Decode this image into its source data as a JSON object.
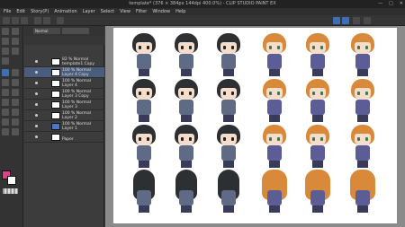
{
  "window": {
    "title": "template* (376 × 384px 144dpi 400.0%) - CLIP STUDIO PAINT EX",
    "controls": [
      "—",
      "□",
      "✕"
    ]
  },
  "menu": [
    "File",
    "Edit",
    "Story(P)",
    "Animation",
    "Layer",
    "Select",
    "View",
    "Filter",
    "Window",
    "Help"
  ],
  "layer_panel": {
    "blend_mode": "Normal",
    "layers": [
      {
        "line1": "82 % Normal",
        "line2": "template1 Copy",
        "selected": false,
        "thumb": "white"
      },
      {
        "line1": "100 % Normal",
        "line2": "Layer 4 Copy",
        "selected": true,
        "thumb": "white"
      },
      {
        "line1": "100 % Normal",
        "line2": "Layer 4",
        "selected": false,
        "thumb": "white"
      },
      {
        "line1": "100 % Normal",
        "line2": "Layer 3 Copy",
        "selected": false,
        "thumb": "white"
      },
      {
        "line1": "100 % Normal",
        "line2": "Layer 3",
        "selected": false,
        "thumb": "white"
      },
      {
        "line1": "100 % Normal",
        "line2": "Layer 2",
        "selected": false,
        "thumb": "white"
      },
      {
        "line1": "100 % Normal",
        "line2": "Layer 1",
        "selected": false,
        "thumb": "blue"
      },
      {
        "line1": "",
        "line2": "Paper",
        "selected": false,
        "thumb": "white"
      }
    ]
  },
  "canvas": {
    "character_a": "boy",
    "character_b": "girl",
    "rows": [
      "front",
      "left",
      "right",
      "back"
    ]
  },
  "colors": {
    "main_color": "#e0408a",
    "sub_color": "#ffffff",
    "accent": "#3d6fb6"
  }
}
